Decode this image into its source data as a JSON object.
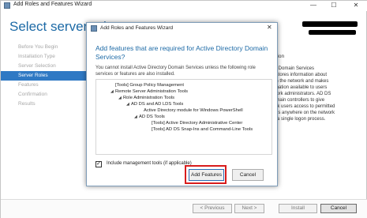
{
  "window": {
    "title": "Add Roles and Features Wizard",
    "controls": {
      "minimize": "—",
      "maximize": "☐",
      "close": "✕"
    },
    "page_title": "Select server role"
  },
  "steps": [
    {
      "label": "Before You Begin",
      "active": false
    },
    {
      "label": "Installation Type",
      "active": false
    },
    {
      "label": "Server Selection",
      "active": false
    },
    {
      "label": "Server Roles",
      "active": true
    },
    {
      "label": "Features",
      "active": false
    },
    {
      "label": "Confirmation",
      "active": false
    },
    {
      "label": "Results",
      "active": false
    }
  ],
  "description": {
    "heading": "ption",
    "text": "ry Domain Services\n) stores information about\non the network and makes\nrmation available to users\nwork administrators. AD DS\nomain controllers to give\nork users access to permitted\nces anywhere on the network\nh a single logon process."
  },
  "footer": {
    "previous": "< Previous",
    "next": "Next >",
    "install": "Install",
    "cancel": "Cancel"
  },
  "dialog": {
    "title": "Add Roles and Features Wizard",
    "close": "✕",
    "heading": "Add features that are required for Active Directory Domain Services?",
    "message": "You cannot install Active Directory Domain Services unless the following role services or features are also installed.",
    "tree": [
      {
        "text": "[Tools] Group Policy Management",
        "level": 1,
        "expander": ""
      },
      {
        "text": "Remote Server Administration Tools",
        "level": 1,
        "expander": "◢"
      },
      {
        "text": "Role Administration Tools",
        "level": 2,
        "expander": "◢"
      },
      {
        "text": "AD DS and AD LDS Tools",
        "level": 3,
        "expander": "◢"
      },
      {
        "text": "Active Directory module for Windows PowerShell",
        "level": 4,
        "expander": ""
      },
      {
        "text": "AD DS Tools",
        "level": 4,
        "expander": "◢"
      },
      {
        "text": "[Tools] Active Directory Administrative Center",
        "level": 5,
        "expander": ""
      },
      {
        "text": "[Tools] AD DS Snap-Ins and Command-Line Tools",
        "level": 5,
        "expander": ""
      }
    ],
    "include_tools": {
      "label": "Include management tools (if applicable)",
      "checked": true,
      "mark": "✓"
    },
    "add_features": "Add Features",
    "cancel": "Cancel"
  },
  "colors": {
    "accent": "#1d6aa6",
    "selected_step": "#2f79c4",
    "highlight": "#d81c1c"
  }
}
